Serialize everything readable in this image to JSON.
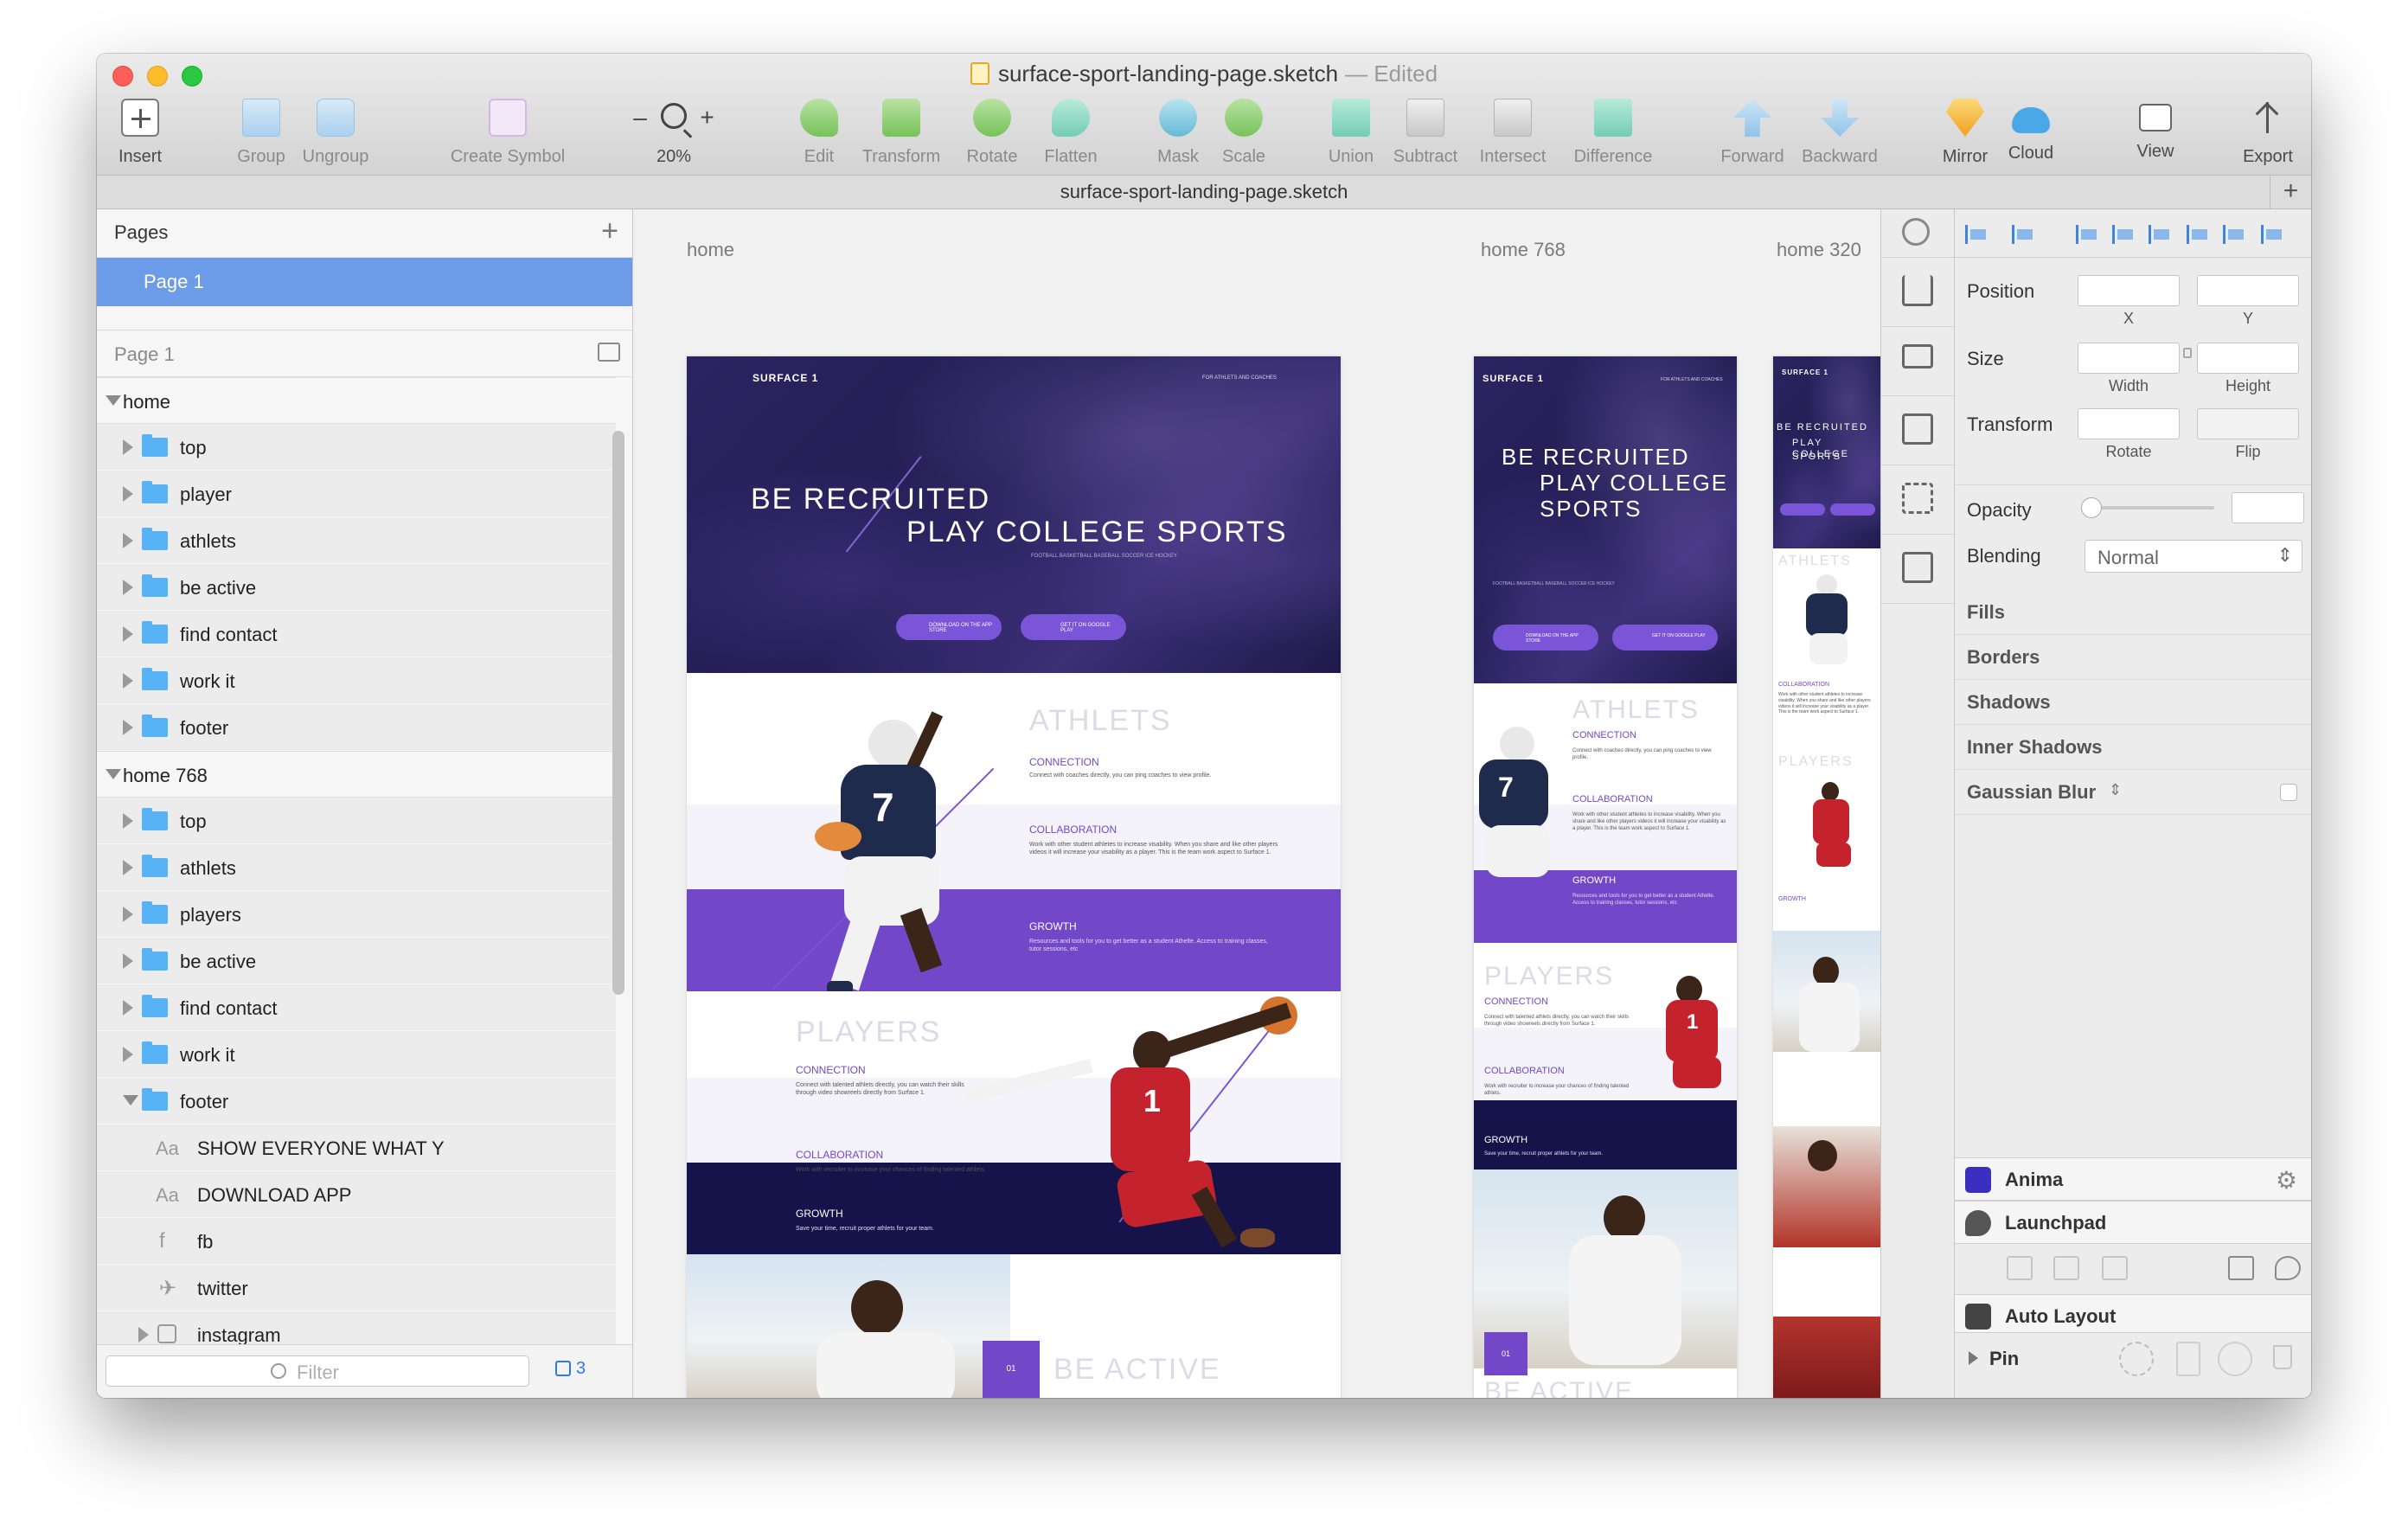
{
  "window": {
    "title": "surface-sport-landing-page.sketch",
    "status": "— Edited",
    "tab_title": "surface-sport-landing-page.sketch"
  },
  "toolbar": {
    "insert": "Insert",
    "group": "Group",
    "ungroup": "Ungroup",
    "create_symbol": "Create Symbol",
    "zoom_minus": "–",
    "zoom_plus": "+",
    "zoom_level": "20%",
    "edit": "Edit",
    "transform": "Transform",
    "rotate": "Rotate",
    "flatten": "Flatten",
    "mask": "Mask",
    "scale": "Scale",
    "union": "Union",
    "subtract": "Subtract",
    "intersect": "Intersect",
    "difference": "Difference",
    "forward": "Forward",
    "backward": "Backward",
    "mirror": "Mirror",
    "cloud": "Cloud",
    "view": "View",
    "export": "Export"
  },
  "sidebar": {
    "pages_header": "Pages",
    "pages": [
      "Page 1"
    ],
    "current_page": "Page 1",
    "layers": [
      {
        "label": "home",
        "kind": "group",
        "expanded": true
      },
      {
        "label": "top",
        "kind": "folder"
      },
      {
        "label": "player",
        "kind": "folder"
      },
      {
        "label": "athlets",
        "kind": "folder"
      },
      {
        "label": "be active",
        "kind": "folder"
      },
      {
        "label": "find contact",
        "kind": "folder"
      },
      {
        "label": "work it",
        "kind": "folder"
      },
      {
        "label": "footer",
        "kind": "folder"
      },
      {
        "label": "home 768",
        "kind": "group",
        "expanded": true
      },
      {
        "label": "top",
        "kind": "folder"
      },
      {
        "label": "athlets",
        "kind": "folder"
      },
      {
        "label": "players",
        "kind": "folder"
      },
      {
        "label": "be active",
        "kind": "folder"
      },
      {
        "label": "find contact",
        "kind": "folder"
      },
      {
        "label": "work it",
        "kind": "folder"
      },
      {
        "label": "footer",
        "kind": "folder",
        "expanded": true
      },
      {
        "label": "SHOW EVERYONE WHAT Y",
        "kind": "text"
      },
      {
        "label": "DOWNLOAD APP",
        "kind": "text"
      },
      {
        "label": "fb",
        "kind": "facebook-icon"
      },
      {
        "label": "twitter",
        "kind": "twitter-icon"
      },
      {
        "label": "instagram",
        "kind": "image-group"
      }
    ],
    "filter_placeholder": "Filter",
    "filter_count": "3"
  },
  "canvas": {
    "artboards": [
      {
        "label": "home"
      },
      {
        "label": "home 768"
      },
      {
        "label": "home 320"
      }
    ],
    "site": {
      "brand": "SURFACE 1",
      "nav": "FOR ATHLETS AND COACHES",
      "headline_1": "BE RECRUITED",
      "headline_2": "PLAY COLLEGE SPORTS",
      "headline_768_2": "PLAY COLLEGE",
      "headline_768_3": "SPORTS",
      "sports": "FOOTBALL     BASKETBALL     BASEBALL     SOCCER     ICE HOCKEY",
      "btn_appstore": "DOWNLOAD ON THE APP STORE",
      "btn_gplay": "GET IT ON GOOGLE PLAY",
      "athlets_title": "ATHLETS",
      "players_title": "PLAYERS",
      "be_active_title": "BE ACTIVE",
      "connection": "CONNECTION",
      "collaboration": "COLLABORATION",
      "growth": "GROWTH",
      "athlets_connection_text": "Connect with coaches directly, you can ping coaches to view profile.",
      "athlets_collab_text": "Work with other student athletes to increase visability. When you share and like other players videos it will increase your visability as a player. This is the team work aspect to Surface 1.",
      "athlets_growth_text": "Resources and tools for you to get better as a student Athelte. Access to training classes, tutor sessions, etc",
      "players_connection_text": "Connect with talented athlets directly, you can watch their skills through video showreels directly from Surface 1.",
      "players_collab_text": "Work with recruiter to increase your chances of finding talented athlets.",
      "players_growth_text": "Save your time, recruit proper athlets for your team.",
      "badge": "01"
    }
  },
  "inspector": {
    "position": "Position",
    "x": "X",
    "y": "Y",
    "size": "Size",
    "width": "Width",
    "height": "Height",
    "transform": "Transform",
    "rotate": "Rotate",
    "flip": "Flip",
    "opacity": "Opacity",
    "blending": "Blending",
    "blending_value": "Normal",
    "fills": "Fills",
    "borders": "Borders",
    "shadows": "Shadows",
    "inner_shadows": "Inner Shadows",
    "gaussian_blur": "Gaussian Blur",
    "plugin_anima": "Anima",
    "plugin_launchpad": "Launchpad",
    "plugin_autolayout": "Auto Layout",
    "pin": "Pin"
  },
  "colors": {
    "accent_purple": "#7248c9",
    "hero_navy": "#2b2460",
    "dark_navy": "#16134a",
    "selection_blue": "#6c9ce8",
    "folder_blue": "#57b3f5"
  }
}
